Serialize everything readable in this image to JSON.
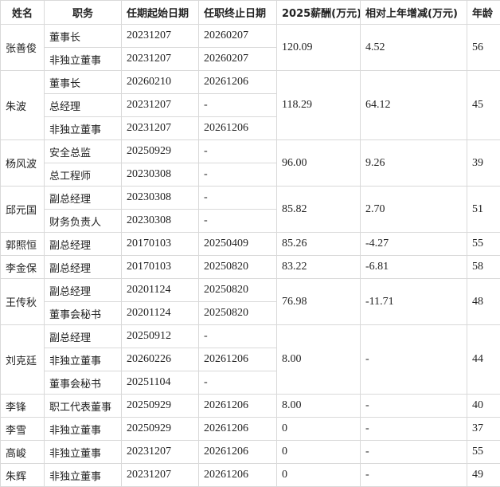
{
  "columns": [
    "姓名",
    "职务",
    "任期起始日期",
    "任职终止日期",
    "2025薪酬(万元)",
    "相对上年增减(万元)",
    "年龄"
  ],
  "people": [
    {
      "name": "张善俊",
      "salary": "120.09",
      "change": "4.52",
      "age": "56",
      "roles": [
        {
          "title": "董事长",
          "start": "20231207",
          "end": "20260207"
        },
        {
          "title": "非独立董事",
          "start": "20231207",
          "end": "20260207"
        }
      ]
    },
    {
      "name": "朱波",
      "salary": "118.29",
      "change": "64.12",
      "age": "45",
      "roles": [
        {
          "title": "董事长",
          "start": "20260210",
          "end": "20261206"
        },
        {
          "title": "总经理",
          "start": "20231207",
          "end": "-"
        },
        {
          "title": "非独立董事",
          "start": "20231207",
          "end": "20261206"
        }
      ]
    },
    {
      "name": "杨风波",
      "salary": "96.00",
      "change": "9.26",
      "age": "39",
      "roles": [
        {
          "title": "安全总监",
          "start": "20250929",
          "end": "-"
        },
        {
          "title": "总工程师",
          "start": "20230308",
          "end": "-"
        }
      ]
    },
    {
      "name": "邱元国",
      "salary": "85.82",
      "change": "2.70",
      "age": "51",
      "roles": [
        {
          "title": "副总经理",
          "start": "20230308",
          "end": "-"
        },
        {
          "title": "财务负责人",
          "start": "20230308",
          "end": "-"
        }
      ]
    },
    {
      "name": "郭照恒",
      "salary": "85.26",
      "change": "-4.27",
      "age": "55",
      "roles": [
        {
          "title": "副总经理",
          "start": "20170103",
          "end": "20250409"
        }
      ]
    },
    {
      "name": "李金保",
      "salary": "83.22",
      "change": "-6.81",
      "age": "58",
      "roles": [
        {
          "title": "副总经理",
          "start": "20170103",
          "end": "20250820"
        }
      ]
    },
    {
      "name": "王传秋",
      "salary": "76.98",
      "change": "-11.71",
      "age": "48",
      "roles": [
        {
          "title": "副总经理",
          "start": "20201124",
          "end": "20250820"
        },
        {
          "title": "董事会秘书",
          "start": "20201124",
          "end": "20250820"
        }
      ]
    },
    {
      "name": "刘克廷",
      "salary": "8.00",
      "change": "-",
      "age": "44",
      "roles": [
        {
          "title": "副总经理",
          "start": "20250912",
          "end": "-"
        },
        {
          "title": "非独立董事",
          "start": "20260226",
          "end": "20261206"
        },
        {
          "title": "董事会秘书",
          "start": "20251104",
          "end": "-"
        }
      ]
    },
    {
      "name": "李锋",
      "salary": "8.00",
      "change": "-",
      "age": "40",
      "roles": [
        {
          "title": "职工代表董事",
          "start": "20250929",
          "end": "20261206"
        }
      ]
    },
    {
      "name": "李雪",
      "salary": "0",
      "change": "-",
      "age": "37",
      "roles": [
        {
          "title": "非独立董事",
          "start": "20250929",
          "end": "20261206"
        }
      ]
    },
    {
      "name": "高峻",
      "salary": "0",
      "change": "-",
      "age": "55",
      "roles": [
        {
          "title": "非独立董事",
          "start": "20231207",
          "end": "20261206"
        }
      ]
    },
    {
      "name": "朱辉",
      "salary": "0",
      "change": "-",
      "age": "49",
      "roles": [
        {
          "title": "非独立董事",
          "start": "20231207",
          "end": "20261206"
        }
      ]
    }
  ]
}
